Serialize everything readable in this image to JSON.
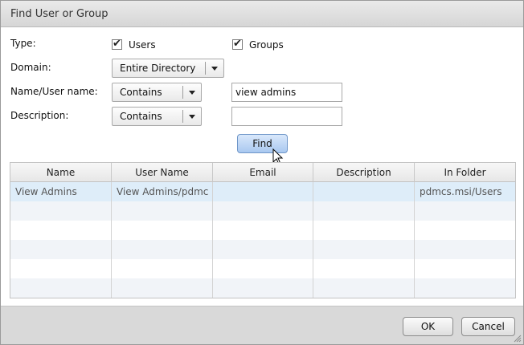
{
  "dialog": {
    "title": "Find User or Group"
  },
  "form": {
    "type_label": "Type:",
    "users_label": "Users",
    "groups_label": "Groups",
    "users_checked": true,
    "groups_checked": true,
    "domain_label": "Domain:",
    "domain_value": "Entire Directory",
    "name_label": "Name/User name:",
    "name_match": "Contains",
    "name_value": "view admins",
    "description_label": "Description:",
    "description_match": "Contains",
    "description_value": "",
    "find_label": "Find"
  },
  "table": {
    "columns": [
      "Name",
      "User Name",
      "Email",
      "Description",
      "In Folder"
    ],
    "rows": [
      [
        "View Admins",
        "View Admins/pdmc",
        "",
        "",
        "pdmcs.msi/Users"
      ]
    ]
  },
  "footer": {
    "ok_label": "OK",
    "cancel_label": "Cancel"
  },
  "icons": {
    "checkbox": "checkmark-icon",
    "dropdown": "chevron-down-icon",
    "cursor": "mouse-pointer-icon",
    "grip": "resize-grip-icon"
  }
}
